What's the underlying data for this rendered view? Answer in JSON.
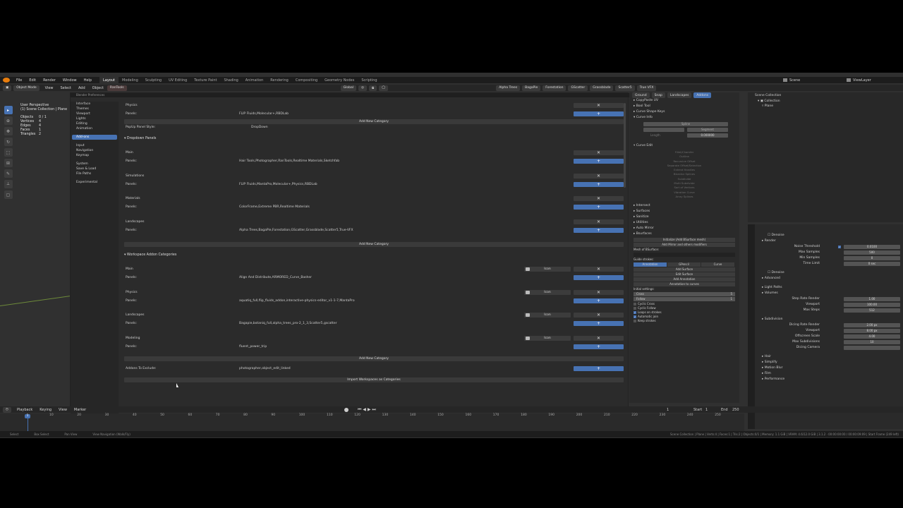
{
  "window_title": "Blender",
  "menubar": {
    "menus": [
      "File",
      "Edit",
      "Render",
      "Window",
      "Help"
    ],
    "workspaces": [
      "Layout",
      "Modeling",
      "Sculpting",
      "UV Editing",
      "Texture Paint",
      "Shading",
      "Animation",
      "Rendering",
      "Compositing",
      "Geometry Nodes",
      "Scripting"
    ],
    "active_workspace": "Layout",
    "scene_label": "Scene",
    "view_layer_label": "ViewLayer"
  },
  "header": {
    "mode": "Object Mode",
    "menus": [
      "View",
      "Select",
      "Add",
      "Object"
    ],
    "addon_tab": "RanTools",
    "orientation": "Global",
    "addon_chips": [
      "Alpha Trees",
      "BagaPie",
      "Forestation",
      "GScatter",
      "Grassblade",
      "Scatter5",
      "True VFX"
    ]
  },
  "overlay_text": {
    "view_name": "User Perspective",
    "collection": "(1) Scene Collection | Plane",
    "stats": [
      {
        "label": "Objects",
        "value": "0 / 1"
      },
      {
        "label": "Vertices",
        "value": "4"
      },
      {
        "label": "Edges",
        "value": "4"
      },
      {
        "label": "Faces",
        "value": "1"
      },
      {
        "label": "Triangles",
        "value": "2"
      }
    ]
  },
  "preferences": {
    "title": "Blender Preferences",
    "sidebar": {
      "group1": [
        "Interface",
        "Themes",
        "Viewport",
        "Lights",
        "Editing",
        "Animation"
      ],
      "group2": [
        "Add-ons"
      ],
      "group3": [
        "Input",
        "Navigation",
        "Keymap"
      ],
      "group4": [
        "System",
        "Save & Load",
        "File Paths"
      ],
      "group5": [
        "Experimental"
      ]
    },
    "add_new_category": "Add New Category",
    "popup_style_label": "PopUp Panel Style:",
    "popup_style_value": "DropDown",
    "dropdown_section": "Dropdown Panels",
    "workspace_section": "Workspace Addon Categories",
    "panels_label": "Panels:",
    "remove_glyph": "✕",
    "add_glyph": "+",
    "icon_label": "Icon",
    "top_category": {
      "name": "Physics",
      "panels": "FLIP Fluids,Molecular+,RBDLab"
    },
    "dropdown_categories": [
      {
        "name": "Main",
        "panels": "Hair Tools,Photographer,RanTools,Realtime Materials,Sketchfab"
      },
      {
        "name": "Simulations",
        "panels": "FLIP Fluids,MantaPro,Molecular+,Physics,RBDLab"
      },
      {
        "name": "Materials",
        "panels": "ColorFrame,Extreme PBR,Realtime Materials"
      },
      {
        "name": "Landscapes",
        "panels": "Alpha Trees,BagaPie,Forestation,GScatter,Grassblade,Scatter5,True-VFX"
      }
    ],
    "workspace_categories": [
      {
        "name": "Main",
        "panels": "Align And Distribute,ARMORED_Curve_Basher"
      },
      {
        "name": "Physics",
        "panels": "aquatiq_full,flip_fluids_addon,interactive-physics-editor_v1-1-7,MantaPro"
      },
      {
        "name": "Landscapes",
        "panels": "Bagapie,botaniq_full,alpha_trees_pro-2_1_3,Scatter5,gscatter"
      },
      {
        "name": "Modeling",
        "panels": "fluent_power_trip"
      }
    ],
    "exclude_label": "Addons To Exclude:",
    "exclude_value": "photographer,object_edit_linked",
    "import_button": "Import Workspaces as Categories"
  },
  "npanel": {
    "tabs": [
      "Ground",
      "Snap",
      "Landscapes",
      "Addons"
    ],
    "items_top": [
      "CopyPaste UV",
      "Bool Tool",
      "Curve Shape Keys",
      "Curve Info"
    ],
    "curve_info_fields": {
      "spline": "Spline",
      "segment": "Segment",
      "length_label": "Length",
      "length_value": "0.000000"
    },
    "curve_edit_title": "Curve Edit",
    "curve_edit_items": [
      "Fillet/Chamfer",
      "Outline",
      "Recursive Offset",
      "Separate Offset/Selection",
      "Extend Handles",
      "Bisector Splines",
      "Subdivide",
      "Multi Subdivide",
      "Sort of Vertices",
      "Vibration Curve",
      "Array Splines"
    ],
    "items_mid": [
      "Intersect",
      "Surfaces",
      "Sanitize",
      "Utilities",
      "Auto Mirror",
      "Bsurfaces"
    ],
    "bsurf_buttons": [
      "Initialize (Add BSurface mesh)",
      "Add Mirror and others modifiers"
    ],
    "mesh_label": "Mesh of BSurface:",
    "guide_label": "Guide strokes:",
    "guide_tabs": [
      "Annotation",
      "GPencil",
      "Curve"
    ],
    "guide_buttons": [
      "Add Surface",
      "Edit Surface",
      "Add Annotation",
      "Annotation to curves"
    ],
    "initial_label": "Initial settings:",
    "initial_fields": [
      {
        "label": "Cross",
        "value": "5"
      },
      {
        "label": "Follow",
        "value": "1"
      }
    ],
    "checks": [
      {
        "label": "Cyclic Cross",
        "checked": false
      },
      {
        "label": "Cyclic Follow",
        "checked": false
      },
      {
        "label": "Loops on strokes",
        "checked": true
      },
      {
        "label": "Automatic join",
        "checked": true
      },
      {
        "label": "Keep strokes",
        "checked": false
      }
    ]
  },
  "outliner": {
    "title": "Scene Collection",
    "items": [
      "Collection",
      "Plane"
    ]
  },
  "properties": {
    "rows": [
      {
        "kind": "check",
        "label": "Denoise"
      },
      {
        "kind": "header",
        "label": "Render"
      },
      {
        "kind": "field",
        "label": "Noise Threshold",
        "value": "0.0100",
        "checkbox": true
      },
      {
        "kind": "field",
        "label": "Max Samples",
        "value": "500"
      },
      {
        "kind": "field",
        "label": "Min Samples",
        "value": "0"
      },
      {
        "kind": "field",
        "label": "Time Limit",
        "value": "0 sec"
      },
      {
        "kind": "gap",
        "label": ""
      },
      {
        "kind": "check",
        "label": "Denoise"
      },
      {
        "kind": "header",
        "label": "Advanced"
      },
      {
        "kind": "gap",
        "label": ""
      },
      {
        "kind": "header",
        "label": "Light Paths"
      },
      {
        "kind": "header",
        "label": "Volumes"
      },
      {
        "kind": "field",
        "label": "Step Rate Render",
        "value": "1.00"
      },
      {
        "kind": "field",
        "label": "Viewport",
        "value": "100.00"
      },
      {
        "kind": "field",
        "label": "Max Steps",
        "value": "512"
      },
      {
        "kind": "gap",
        "label": ""
      },
      {
        "kind": "header",
        "label": "Subdivision"
      },
      {
        "kind": "field",
        "label": "Dicing Rate Render",
        "value": "2.00 px"
      },
      {
        "kind": "field",
        "label": "Viewport",
        "value": "8.00 px"
      },
      {
        "kind": "field",
        "label": "Offscreen Scale",
        "value": "4.00"
      },
      {
        "kind": "field",
        "label": "Max Subdivisions",
        "value": "10"
      },
      {
        "kind": "field",
        "label": "Dicing Camera",
        "value": ""
      },
      {
        "kind": "gap",
        "label": ""
      },
      {
        "kind": "header",
        "label": "Hair"
      },
      {
        "kind": "header",
        "label": "Simplify"
      },
      {
        "kind": "header",
        "label": "Motion Blur"
      },
      {
        "kind": "header",
        "label": "Film"
      },
      {
        "kind": "header",
        "label": "Performance"
      }
    ]
  },
  "timeline": {
    "menus": [
      "Playback",
      "Keying",
      "View",
      "Marker"
    ],
    "current_frame": "1",
    "start_label": "Start",
    "start_value": "1",
    "end_label": "End",
    "end_value": "250",
    "ticks": [
      "10",
      "20",
      "30",
      "40",
      "50",
      "60",
      "70",
      "80",
      "90",
      "100",
      "110",
      "120",
      "130",
      "140",
      "150",
      "160",
      "170",
      "180",
      "190",
      "200",
      "210",
      "220",
      "230",
      "240",
      "250"
    ]
  },
  "statusbar": {
    "left": [
      "Select",
      "Box Select",
      "Pan View",
      "View Navigation (Walk/Fly)"
    ],
    "right": "Scene Collection | Plane | Verts:4 | Faces:1 | Tris:2 | Objects:0/1 | Memory: 1.1 GiB | VRAM: 4.6/12.0 GiB | 3.1.2 · 00:00:00:00 / 00:00:09:09 | Start Frame (249 left)"
  },
  "colors": {
    "accent": "#4772b3",
    "bg": "#303030",
    "panel": "#2b2b2b",
    "bar": "#1d1d1d"
  }
}
